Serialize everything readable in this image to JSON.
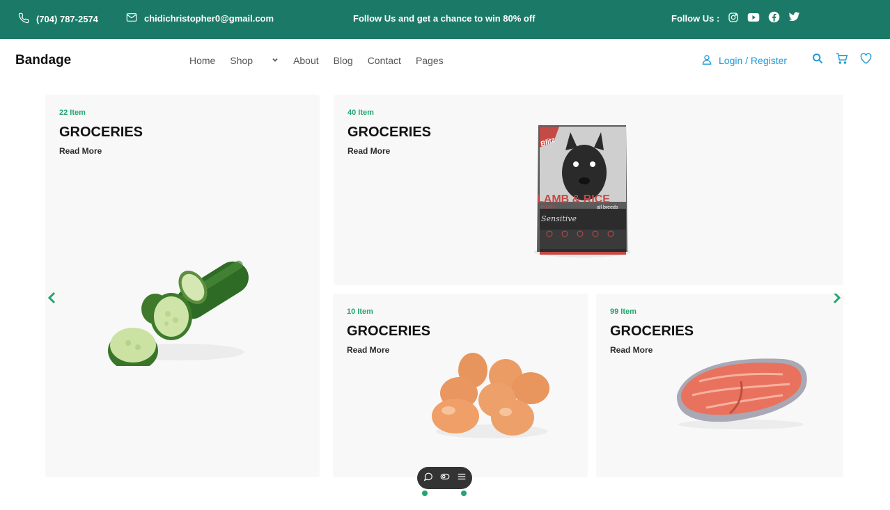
{
  "topbar": {
    "phone": "(704) 787-2574",
    "email": "chidichristopher0@gmail.com",
    "promo": "Follow Us and get a chance to win 80% off",
    "follow_label": "Follow Us :",
    "socials": [
      "instagram-icon",
      "youtube-icon",
      "facebook-icon",
      "twitter-icon"
    ]
  },
  "nav": {
    "brand": "Bandage",
    "menu": [
      "Home",
      "Shop",
      "About",
      "Blog",
      "Contact",
      "Pages"
    ],
    "login": "Login / Register"
  },
  "cards": [
    {
      "count": "22 Item",
      "title": "GROCERIES",
      "more": "Read More"
    },
    {
      "count": "40 Item",
      "title": "GROCERIES",
      "more": "Read More"
    },
    {
      "count": "10 Item",
      "title": "GROCERIES",
      "more": "Read More"
    },
    {
      "count": "99 Item",
      "title": "GROCERIES",
      "more": "Read More"
    }
  ],
  "product_packaging": {
    "brand": "Blitz",
    "product": "LAMB & RICE",
    "subtitle": "PUPPY",
    "variant": "Sensitive",
    "tag": "all breeds"
  },
  "colors": {
    "topbar_bg": "#1b7a67",
    "accent_green": "#23a56f",
    "link_blue": "#1e9ad6"
  }
}
